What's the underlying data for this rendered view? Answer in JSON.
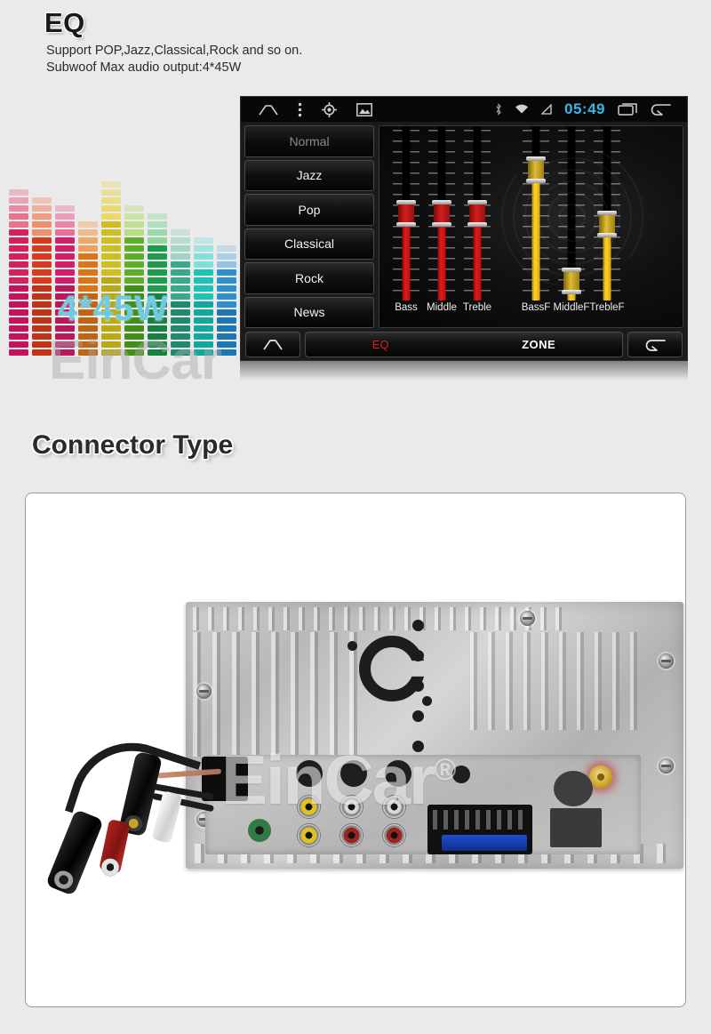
{
  "eq": {
    "title": "EQ",
    "desc_line1": "Support POP,Jazz,Classical,Rock and so on.",
    "desc_line2": "Subwoof Max audio output:4*45W",
    "art_watt": "4*45W",
    "art_watermark": "EinCar",
    "statusbar": {
      "home_icon": "home-icon",
      "menu_icon": "overflow-menu-icon",
      "gps_icon": "gps-crosshair-icon",
      "gallery_icon": "gallery-icon",
      "bluetooth_icon": "bluetooth-icon",
      "wifi_icon": "wifi-icon",
      "signal_icon": "signal-icon",
      "clock": "05:49",
      "recents_icon": "recents-icon",
      "back_icon": "back-icon",
      "clock_color": "#39b6e8"
    },
    "presets": [
      {
        "label": "Normal",
        "selected": true
      },
      {
        "label": "Jazz",
        "selected": false
      },
      {
        "label": "Pop",
        "selected": false
      },
      {
        "label": "Classical",
        "selected": false
      },
      {
        "label": "Rock",
        "selected": false
      },
      {
        "label": "News",
        "selected": false
      }
    ],
    "sliders": [
      {
        "label": "Bass",
        "value": 50,
        "color": "red"
      },
      {
        "label": "Middle",
        "value": 50,
        "color": "red"
      },
      {
        "label": "Treble",
        "value": 50,
        "color": "red"
      },
      {
        "label": "BassF",
        "value": 75,
        "color": "gold"
      },
      {
        "label": "MiddleF",
        "value": 11,
        "color": "gold"
      },
      {
        "label": "TrebleF",
        "value": 44,
        "color": "gold"
      }
    ],
    "toolbar": {
      "home_icon": "home-icon",
      "eq_label": "EQ",
      "zone_label": "ZONE",
      "back_icon": "back-icon",
      "eq_active_color": "#d61f1f"
    }
  },
  "connector": {
    "title": "Connector Type",
    "photo_watermark": "EinCar",
    "photo_watermark_mark": "®",
    "photo_alt": "rear-panel-connectors-photo"
  },
  "colors": {
    "page_bg": "#eaeaea",
    "card_bg": "#ffffff",
    "card_border": "#9a9a9a",
    "screen_bg": "#111111",
    "accent_cyan": "#6fcbe3"
  }
}
